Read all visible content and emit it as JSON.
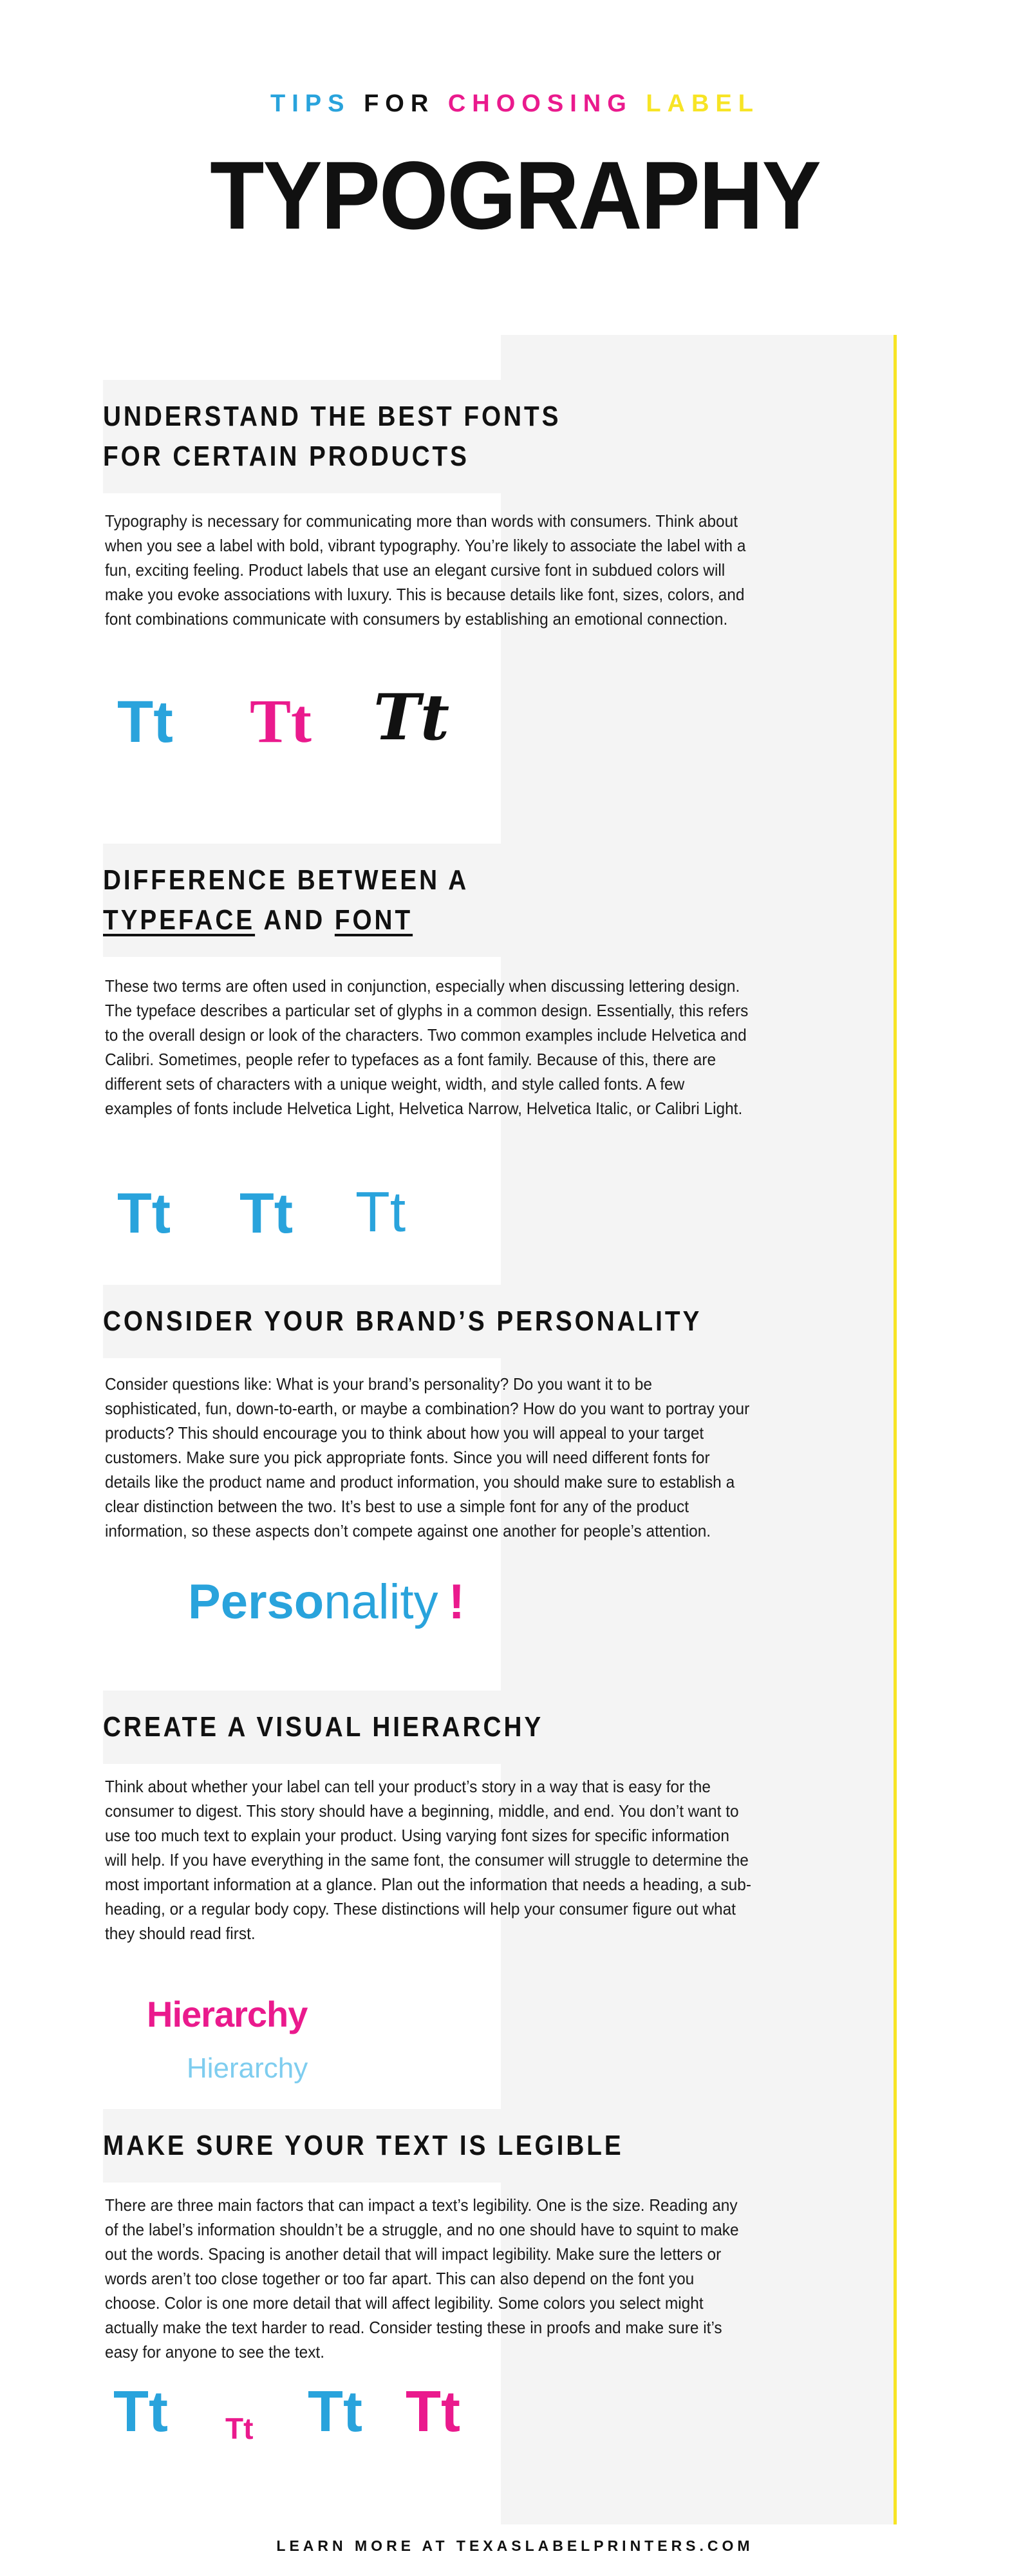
{
  "colors": {
    "cyan": "#29a3dc",
    "cyan_light": "#7ecdef",
    "magenta": "#ea1a8d",
    "yellow": "#f7e425",
    "black": "#111111",
    "panel_gray": "#f4f4f4"
  },
  "header": {
    "kicker_tips": "TIPS",
    "kicker_for": "FOR",
    "kicker_choosing": "CHOOSING",
    "kicker_label": "LABEL",
    "title": "TYPOGRAPHY"
  },
  "sections": [
    {
      "heading_line1": "UNDERSTAND THE BEST FONTS",
      "heading_line2": "FOR CERTAIN PRODUCTS",
      "body": "Typography is necessary for communicating more than words with consumers. Think about when you see a label with bold, vibrant typography. You’re likely to associate the label with a fun, exciting feeling. Product labels that use an elegant cursive font in subdued colors will make you evoke associations with luxury. This is because details like font, sizes, colors, and font combinations communicate with consumers by establishing an emotional connection.",
      "samples": [
        {
          "text": "Tt",
          "style": "sans-black",
          "color": "cyan"
        },
        {
          "text": "Tt",
          "style": "serif",
          "color": "magenta"
        },
        {
          "text": "Tt",
          "style": "cursive",
          "color": "black"
        }
      ]
    },
    {
      "heading_line1": "DIFFERENCE BETWEEN A",
      "heading_line2_a": "TYPEFACE",
      "heading_line2_b": "AND",
      "heading_line2_c": "FONT",
      "body": "These two terms are often used in conjunction, especially when discussing lettering design. The typeface describes a particular set of glyphs in a common design. Essentially, this refers to the overall design or look of the characters. Two common examples include Helvetica and Calibri. Sometimes, people refer to typefaces as a font family. Because of this, there are different sets of characters with a unique weight, width, and style called fonts. A few examples of fonts include Helvetica Light, Helvetica Narrow, Helvetica Italic, or Calibri Light.",
      "samples": [
        {
          "text": "Tt",
          "style": "sans-black",
          "color": "cyan"
        },
        {
          "text": "Tt",
          "style": "sans-bold",
          "color": "cyan"
        },
        {
          "text": "Tt",
          "style": "sans-light",
          "color": "cyan"
        }
      ]
    },
    {
      "heading_line1": "CONSIDER YOUR BRAND’S PERSONALITY",
      "body": "Consider questions like: What is your brand’s personality? Do you want it to be sophisticated, fun, down-to-earth, or maybe a combination? How do you want to portray your products? This should encourage you to think about how you will appeal to your target customers. Make sure you pick appropriate fonts. Since you will need different fonts for details like the product name and product information, you should make sure to establish a clear distinction between the two. It’s best to use a simple font for any of the product information, so these aspects don’t compete against one another for people’s attention.",
      "sample_word_bold": "Perso",
      "sample_word_light": "nality",
      "sample_word_mark": "!"
    },
    {
      "heading_line1": "CREATE A VISUAL HIERARCHY",
      "body": "Think about whether your label can tell your product’s story in a way that is easy for the consumer to digest. This story should have a beginning, middle, and end. You don’t want to use too much text to explain your product. Using varying font sizes for specific information will help. If you have everything in the same font, the consumer will struggle to determine the most important information at a glance. Plan out the information that needs a heading, a sub-heading, or a regular body copy. These distinctions will help your consumer figure out what they should read first.",
      "sample_primary": "Hierarchy",
      "sample_secondary": "Hierarchy"
    },
    {
      "heading_line1": "MAKE SURE YOUR TEXT IS LEGIBLE",
      "body": "There are three main factors that can impact a text’s legibility. One is the size. Reading any of the label’s information shouldn’t be a struggle, and no one should have to squint to make out the words. Spacing is another detail that will impact legibility. Make sure the letters or words aren’t too close together or too far apart. This can also depend on the font you choose. Color is one more detail that will affect legibility. Some colors you select might actually make the text harder to read. Consider testing these in proofs and make sure it’s easy for anyone to see the text.",
      "samples": [
        {
          "text": "Tt",
          "style": "sans-black",
          "color": "cyan",
          "size": "large"
        },
        {
          "text": "Tt",
          "style": "sans-black",
          "color": "magenta",
          "size": "small"
        },
        {
          "text": "Tt",
          "style": "sans-black",
          "color": "cyan",
          "size": "large"
        },
        {
          "text": "Tt",
          "style": "sans-black",
          "color": "magenta",
          "size": "large"
        }
      ]
    }
  ],
  "footer": {
    "text": "LEARN MORE AT TEXASLABELPRINTERS.COM"
  }
}
